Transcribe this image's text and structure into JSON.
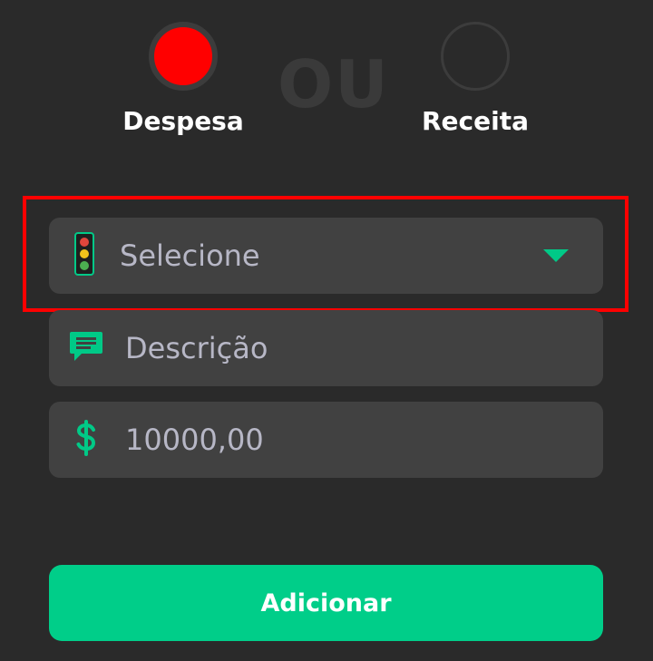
{
  "type_toggle": {
    "despesa_label": "Despesa",
    "receita_label": "Receita",
    "separator": "OU",
    "selected": "despesa",
    "despesa_color": "#ff0000"
  },
  "form": {
    "category": {
      "icon": "traffic-light-icon",
      "value": "Selecione"
    },
    "description": {
      "icon": "message-icon",
      "placeholder": "Descrição"
    },
    "amount": {
      "icon": "dollar-icon",
      "value": "10000,00"
    }
  },
  "submit": {
    "label": "Adicionar",
    "color": "#00ce89"
  },
  "accent_color": "#00c987"
}
